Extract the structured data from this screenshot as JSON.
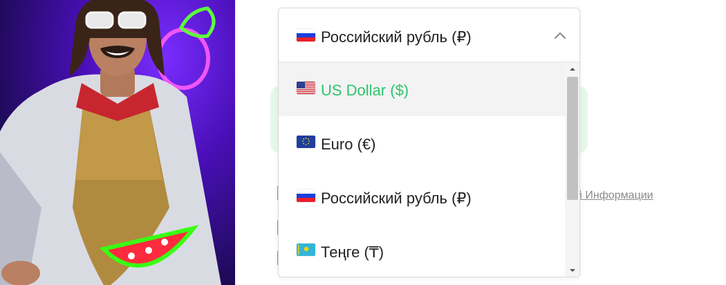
{
  "currency_select": {
    "selected": {
      "label": "Российский рубль (₽)",
      "flag": "russia-flag-icon"
    },
    "toggle_icon": "chevron-up-icon",
    "options": [
      {
        "label": "US Dollar ($)",
        "flag": "usa-flag-icon",
        "highlighted": true
      },
      {
        "label": "Euro (€)",
        "flag": "eu-flag-icon",
        "highlighted": false
      },
      {
        "label": "Российский рубль (₽)",
        "flag": "russia-flag-icon",
        "highlighted": false
      },
      {
        "label": "Теңге (₸)",
        "flag": "kazakhstan-flag-icon",
        "highlighted": false
      }
    ]
  },
  "background": {
    "policy_link_text": "итой Информации"
  },
  "colors": {
    "accent_green": "#2ec56a",
    "promo_purple": "#4a0fb8",
    "neon_green": "#39ff14",
    "neon_red": "#ff2a3d"
  }
}
